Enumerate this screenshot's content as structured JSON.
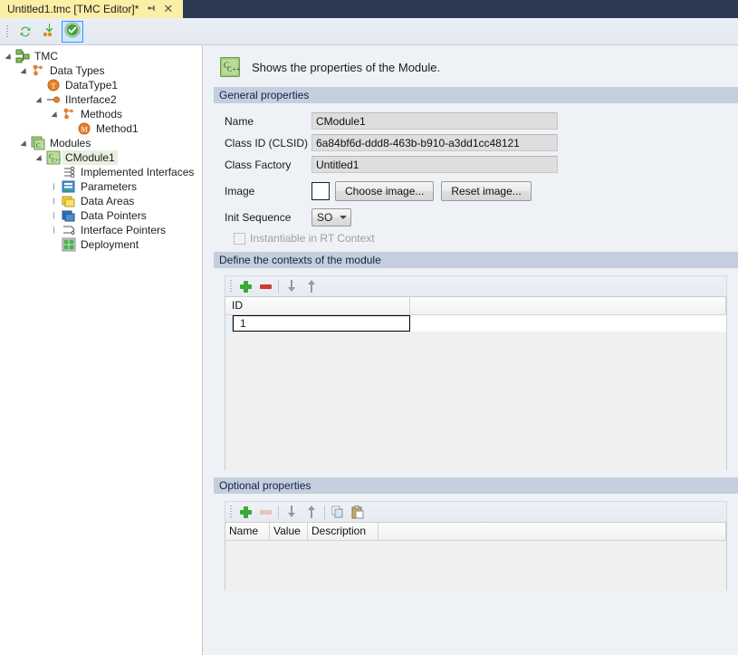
{
  "tab": {
    "title": "Untitled1.tmc [TMC Editor]*",
    "pin_icon": "pin-icon",
    "close_icon": "close-icon"
  },
  "toolbar": {
    "buttons": [
      {
        "name": "refresh-button",
        "icon": "refresh-icon",
        "active": false
      },
      {
        "name": "import-button",
        "icon": "import-arrow-icon",
        "active": false
      },
      {
        "name": "validate-button",
        "icon": "check-circle-icon",
        "active": true
      }
    ]
  },
  "tree": {
    "nodes": [
      {
        "label": "TMC",
        "depth": 0,
        "twist": "open",
        "icon": "tmc-icon",
        "selected": false
      },
      {
        "label": "Data Types",
        "depth": 1,
        "twist": "open",
        "icon": "data-types-icon",
        "selected": false
      },
      {
        "label": "DataType1",
        "depth": 2,
        "twist": "none",
        "icon": "datatype-icon",
        "selected": false
      },
      {
        "label": "IInterface2",
        "depth": 2,
        "twist": "open",
        "icon": "interface-icon",
        "selected": false
      },
      {
        "label": "Methods",
        "depth": 3,
        "twist": "open",
        "icon": "methods-icon",
        "selected": false
      },
      {
        "label": "Method1",
        "depth": 4,
        "twist": "none",
        "icon": "method-icon",
        "selected": false
      },
      {
        "label": "Modules",
        "depth": 1,
        "twist": "open",
        "icon": "modules-icon",
        "selected": false
      },
      {
        "label": "CModule1",
        "depth": 2,
        "twist": "open",
        "icon": "module-icon",
        "selected": true
      },
      {
        "label": "Implemented Interfaces",
        "depth": 3,
        "twist": "none",
        "icon": "implemented-interfaces-icon",
        "selected": false
      },
      {
        "label": "Parameters",
        "depth": 3,
        "twist": "closed",
        "icon": "parameters-icon",
        "selected": false
      },
      {
        "label": "Data Areas",
        "depth": 3,
        "twist": "closed",
        "icon": "data-areas-icon",
        "selected": false
      },
      {
        "label": "Data Pointers",
        "depth": 3,
        "twist": "closed",
        "icon": "data-pointers-icon",
        "selected": false
      },
      {
        "label": "Interface Pointers",
        "depth": 3,
        "twist": "closed",
        "icon": "interface-pointers-icon",
        "selected": false
      },
      {
        "label": "Deployment",
        "depth": 3,
        "twist": "none",
        "icon": "deployment-icon",
        "selected": false
      }
    ]
  },
  "page": {
    "icon": "cpp-module-icon",
    "description": "Shows the properties of the Module."
  },
  "general": {
    "header": "General properties",
    "name_label": "Name",
    "name_value": "CModule1",
    "clsid_label": "Class ID (CLSID)",
    "clsid_value": "6a84bf6d-ddd8-463b-b910-a3dd1cc48121",
    "factory_label": "Class Factory",
    "factory_value": "Untitled1",
    "image_label": "Image",
    "choose_image_label": "Choose image...",
    "reset_image_label": "Reset image...",
    "init_sequence_label": "Init Sequence",
    "init_sequence_value": "SO",
    "instantiable_label": "Instantiable in RT Context",
    "instantiable_checked": false
  },
  "contexts": {
    "header": "Define the contexts of the module",
    "toolbar": [
      {
        "name": "add-context-button",
        "icon": "plus-icon",
        "disabled": false
      },
      {
        "name": "remove-context-button",
        "icon": "minus-icon",
        "disabled": false
      },
      {
        "name": "move-down-button",
        "icon": "arrow-down-icon",
        "disabled": false
      },
      {
        "name": "move-up-button",
        "icon": "arrow-up-icon",
        "disabled": false
      }
    ],
    "columns": [
      "ID",
      ""
    ],
    "rows": [
      {
        "id": "1",
        "selected": true
      }
    ]
  },
  "optional": {
    "header": "Optional properties",
    "toolbar": [
      {
        "name": "add-property-button",
        "icon": "plus-icon",
        "disabled": false
      },
      {
        "name": "remove-property-button",
        "icon": "minus-icon",
        "disabled": true
      },
      {
        "name": "move-down-button",
        "icon": "arrow-down-icon",
        "disabled": false
      },
      {
        "name": "move-up-button",
        "icon": "arrow-up-icon",
        "disabled": false
      },
      {
        "name": "copy-button",
        "icon": "copy-icon",
        "disabled": false
      },
      {
        "name": "paste-button",
        "icon": "paste-icon",
        "disabled": false
      }
    ],
    "columns": [
      "Name",
      "Value",
      "Description"
    ],
    "rows": []
  },
  "colors": {
    "tab_active": "#fbefa6",
    "tabstrip_bg": "#2d3a52",
    "section_header": "#c4cede",
    "panel_bg": "#eef1f5",
    "accent_green": "#3ba935",
    "accent_red": "#cc3b31"
  }
}
